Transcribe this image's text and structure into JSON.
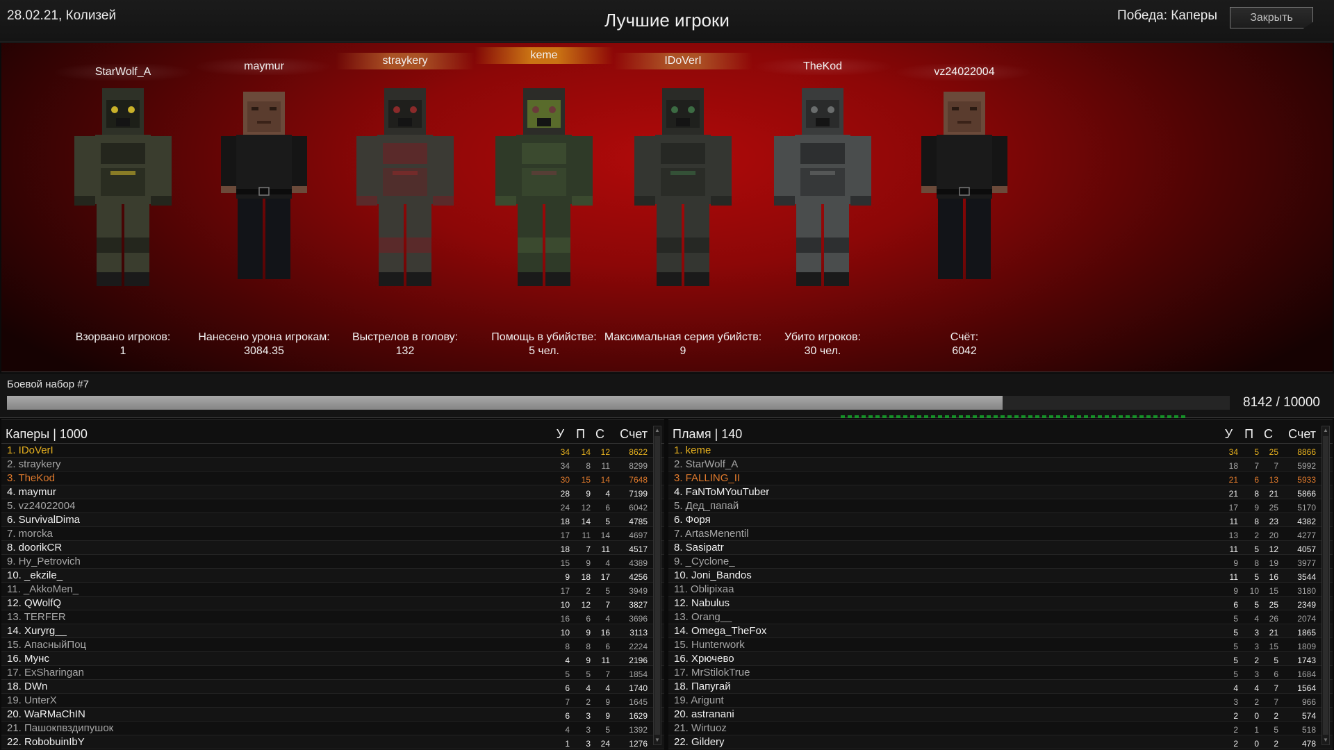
{
  "header": {
    "date_location": "28.02.21, Колизей",
    "title": "Лучшие игроки",
    "victory": "Победа: Каперы",
    "close_label": "Закрыть"
  },
  "podium": [
    {
      "name": "StarWolf_A",
      "label": "Взорвано игроков:",
      "value": "1",
      "highlight": "none",
      "skin": "armor-dark-goggles"
    },
    {
      "name": "maymur",
      "label": "Нанесено урона игрокам:",
      "value": "3084.35",
      "highlight": "none",
      "skin": "plain-black"
    },
    {
      "name": "straykery",
      "label": "Выстрелов в голову:",
      "value": "132",
      "highlight": "orange",
      "skin": "armor-red"
    },
    {
      "name": "keme",
      "label": "Помощь в убийстве:",
      "value": "5 чел.",
      "highlight": "gold",
      "skin": "armor-green-camo"
    },
    {
      "name": "IDoVerI",
      "label": "Максимальная серия убийств:",
      "value": "9",
      "highlight": "orange",
      "skin": "armor-dark"
    },
    {
      "name": "TheKod",
      "label": "Убито игроков:",
      "value": "30 чел.",
      "highlight": "none",
      "skin": "armor-gray-camo"
    },
    {
      "name": "vz24022004",
      "label": "Счёт:",
      "value": "6042",
      "highlight": "none",
      "skin": "plain-black"
    }
  ],
  "kit": {
    "label": "Боевой набор #7",
    "value_text": "8142 / 10000",
    "progress": 0.8142
  },
  "columns": {
    "kills": "У",
    "deaths": "П",
    "assists": "С",
    "score": "Счет"
  },
  "teams": [
    {
      "title": "Каперы | 1000",
      "rows": [
        {
          "name": "1. IDoVerI",
          "k": "34",
          "d": "14",
          "a": "12",
          "s": "8622",
          "color": "gold"
        },
        {
          "name": "2. straykery",
          "k": "34",
          "d": "8",
          "a": "11",
          "s": "8299",
          "color": "gray"
        },
        {
          "name": "3. TheKod",
          "k": "30",
          "d": "15",
          "a": "14",
          "s": "7648",
          "color": "orange"
        },
        {
          "name": "4. maymur",
          "k": "28",
          "d": "9",
          "a": "4",
          "s": "7199",
          "color": "white"
        },
        {
          "name": "5. vz24022004",
          "k": "24",
          "d": "12",
          "a": "6",
          "s": "6042",
          "color": "gray"
        },
        {
          "name": "6. SurvivalDima",
          "k": "18",
          "d": "14",
          "a": "5",
          "s": "4785",
          "color": "white"
        },
        {
          "name": "7. morcka",
          "k": "17",
          "d": "11",
          "a": "14",
          "s": "4697",
          "color": "gray"
        },
        {
          "name": "8. doorikCR",
          "k": "18",
          "d": "7",
          "a": "11",
          "s": "4517",
          "color": "white"
        },
        {
          "name": "9. Hy_Petrovich",
          "k": "15",
          "d": "9",
          "a": "4",
          "s": "4389",
          "color": "gray"
        },
        {
          "name": "10. _ekzile_",
          "k": "9",
          "d": "18",
          "a": "17",
          "s": "4256",
          "color": "white"
        },
        {
          "name": "11. _AkkoMen_",
          "k": "17",
          "d": "2",
          "a": "5",
          "s": "3949",
          "color": "gray"
        },
        {
          "name": "12. QWolfQ",
          "k": "10",
          "d": "12",
          "a": "7",
          "s": "3827",
          "color": "white"
        },
        {
          "name": "13. TERFER",
          "k": "16",
          "d": "6",
          "a": "4",
          "s": "3696",
          "color": "gray"
        },
        {
          "name": "14. Xuryrg__",
          "k": "10",
          "d": "9",
          "a": "16",
          "s": "3113",
          "color": "white"
        },
        {
          "name": "15. АпасныйПоц",
          "k": "8",
          "d": "8",
          "a": "6",
          "s": "2224",
          "color": "gray"
        },
        {
          "name": "16. Мунс",
          "k": "4",
          "d": "9",
          "a": "11",
          "s": "2196",
          "color": "white"
        },
        {
          "name": "17. ExSharingan",
          "k": "5",
          "d": "5",
          "a": "7",
          "s": "1854",
          "color": "gray"
        },
        {
          "name": "18. DWn",
          "k": "6",
          "d": "4",
          "a": "4",
          "s": "1740",
          "color": "white"
        },
        {
          "name": "19. UnterX",
          "k": "7",
          "d": "2",
          "a": "9",
          "s": "1645",
          "color": "gray"
        },
        {
          "name": "20. WaRMaChIN",
          "k": "6",
          "d": "3",
          "a": "9",
          "s": "1629",
          "color": "white"
        },
        {
          "name": "21. Пашокпвздипушок",
          "k": "4",
          "d": "3",
          "a": "5",
          "s": "1392",
          "color": "gray"
        },
        {
          "name": "22. RobobuinIbY",
          "k": "1",
          "d": "3",
          "a": "24",
          "s": "1276",
          "color": "white"
        }
      ]
    },
    {
      "title": "Пламя | 140",
      "rows": [
        {
          "name": "1. keme",
          "k": "34",
          "d": "5",
          "a": "25",
          "s": "8866",
          "color": "gold"
        },
        {
          "name": "2. StarWolf_A",
          "k": "18",
          "d": "7",
          "a": "7",
          "s": "5992",
          "color": "gray"
        },
        {
          "name": "3. FALLING_II",
          "k": "21",
          "d": "6",
          "a": "13",
          "s": "5933",
          "color": "orange"
        },
        {
          "name": "4. FaNToMYouTuber",
          "k": "21",
          "d": "8",
          "a": "21",
          "s": "5866",
          "color": "white"
        },
        {
          "name": "5. Дед_папай",
          "k": "17",
          "d": "9",
          "a": "25",
          "s": "5170",
          "color": "gray"
        },
        {
          "name": "6. Форя",
          "k": "11",
          "d": "8",
          "a": "23",
          "s": "4382",
          "color": "white"
        },
        {
          "name": "7. ArtasMenentil",
          "k": "13",
          "d": "2",
          "a": "20",
          "s": "4277",
          "color": "gray"
        },
        {
          "name": "8. Sasipatr",
          "k": "11",
          "d": "5",
          "a": "12",
          "s": "4057",
          "color": "white"
        },
        {
          "name": "9. _Cyclone_",
          "k": "9",
          "d": "8",
          "a": "19",
          "s": "3977",
          "color": "gray"
        },
        {
          "name": "10. Joni_Bandos",
          "k": "11",
          "d": "5",
          "a": "16",
          "s": "3544",
          "color": "white"
        },
        {
          "name": "11. Oblipixaa",
          "k": "9",
          "d": "10",
          "a": "15",
          "s": "3180",
          "color": "gray"
        },
        {
          "name": "12. Nabulus",
          "k": "6",
          "d": "5",
          "a": "25",
          "s": "2349",
          "color": "white"
        },
        {
          "name": "13. Orang__",
          "k": "5",
          "d": "4",
          "a": "26",
          "s": "2074",
          "color": "gray"
        },
        {
          "name": "14. Omega_TheFox",
          "k": "5",
          "d": "3",
          "a": "21",
          "s": "1865",
          "color": "white"
        },
        {
          "name": "15. Hunterwork",
          "k": "5",
          "d": "3",
          "a": "15",
          "s": "1809",
          "color": "gray"
        },
        {
          "name": "16. Хрючево",
          "k": "5",
          "d": "2",
          "a": "5",
          "s": "1743",
          "color": "white"
        },
        {
          "name": "17. MrStilokTrue",
          "k": "5",
          "d": "3",
          "a": "6",
          "s": "1684",
          "color": "gray"
        },
        {
          "name": "18. Пaпугай",
          "k": "4",
          "d": "4",
          "a": "7",
          "s": "1564",
          "color": "white"
        },
        {
          "name": "19. Arigunt",
          "k": "3",
          "d": "2",
          "a": "7",
          "s": "966",
          "color": "gray"
        },
        {
          "name": "20. astranani",
          "k": "2",
          "d": "0",
          "a": "2",
          "s": "574",
          "color": "white"
        },
        {
          "name": "21. Wirtuoz",
          "k": "2",
          "d": "1",
          "a": "5",
          "s": "518",
          "color": "gray"
        },
        {
          "name": "22. Gildery",
          "k": "2",
          "d": "0",
          "a": "2",
          "s": "478",
          "color": "white"
        }
      ]
    }
  ],
  "colors": {
    "gold": "#e7b11f",
    "orange": "#e07a2c",
    "white": "#f0f0f0",
    "gray": "#a6a6a6",
    "podium_red": "#b00a0a"
  }
}
